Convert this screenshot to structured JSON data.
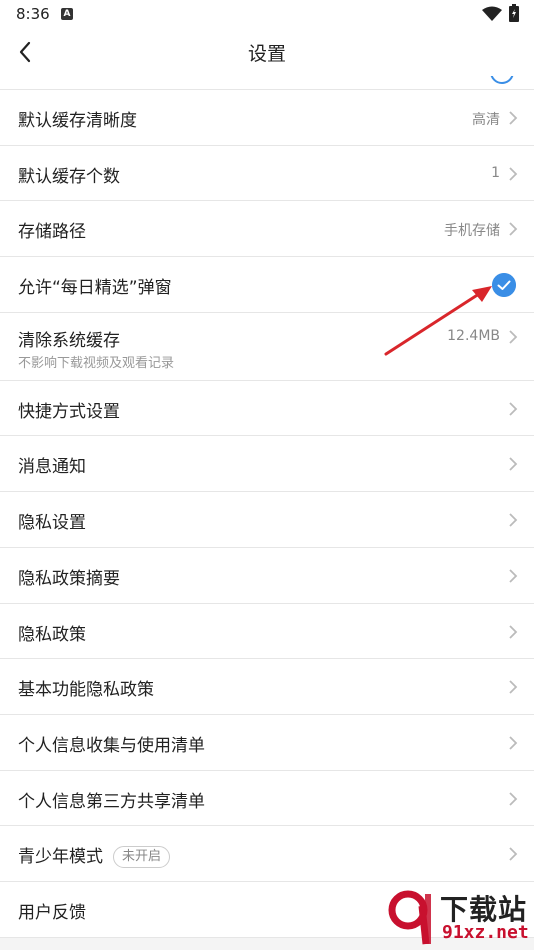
{
  "status_bar": {
    "time": "8:36",
    "notification_icon": "A"
  },
  "header": {
    "title": "设置"
  },
  "settings": [
    {
      "label": "默认缓存清晰度",
      "value": "高清"
    },
    {
      "label": "默认缓存个数",
      "value": "1"
    },
    {
      "label": "存储路径",
      "value": "手机存储"
    },
    {
      "label": "允许“每日精选”弹窗",
      "checked": true
    },
    {
      "label": "清除系统缓存",
      "sublabel": "不影响下载视频及观看记录",
      "value": "12.4MB"
    },
    {
      "label": "快捷方式设置"
    },
    {
      "label": "消息通知"
    },
    {
      "label": "隐私设置"
    },
    {
      "label": "隐私政策摘要"
    },
    {
      "label": "隐私政策"
    },
    {
      "label": "基本功能隐私政策"
    },
    {
      "label": "个人信息收集与使用清单"
    },
    {
      "label": "个人信息第三方共享清单"
    },
    {
      "label": "青少年模式",
      "badge": "未开启"
    },
    {
      "label": "用户反馈"
    }
  ],
  "watermark": {
    "brand": "下载站",
    "domain": "91xz.net"
  },
  "colors": {
    "accent": "#3a8ee6",
    "arrow": "#d9262b"
  }
}
